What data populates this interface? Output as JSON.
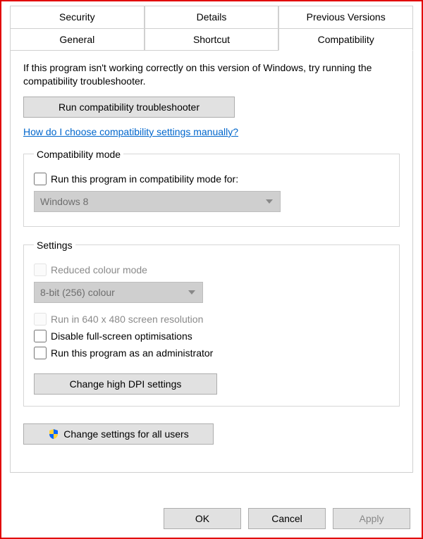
{
  "tabs": {
    "row1": [
      "Security",
      "Details",
      "Previous Versions"
    ],
    "row2": [
      "General",
      "Shortcut",
      "Compatibility"
    ],
    "active": "Compatibility"
  },
  "intro": "If this program isn't working correctly on this version of Windows, try running the compatibility troubleshooter.",
  "troubleshooter_button": "Run compatibility troubleshooter",
  "help_link": "How do I choose compatibility settings manually?",
  "compat_mode": {
    "legend": "Compatibility mode",
    "checkbox_label": "Run this program in compatibility mode for:",
    "dropdown_value": "Windows 8"
  },
  "settings": {
    "legend": "Settings",
    "reduced_colour_label": "Reduced colour mode",
    "colour_dropdown_value": "8-bit (256) colour",
    "low_res_label": "Run in 640 x 480 screen resolution",
    "disable_fullscreen_label": "Disable full-screen optimisations",
    "run_as_admin_label": "Run this program as an administrator",
    "change_dpi_button": "Change high DPI settings"
  },
  "change_all_users_button": "Change settings for all users",
  "buttons": {
    "ok": "OK",
    "cancel": "Cancel",
    "apply": "Apply"
  }
}
